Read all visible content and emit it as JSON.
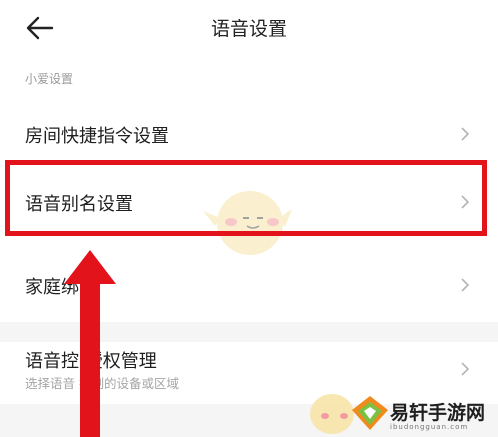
{
  "header": {
    "title": "语音设置",
    "back_icon": "arrow-left-icon"
  },
  "section": {
    "label": "小爱设置"
  },
  "items": [
    {
      "label": "房间快捷指令设置"
    },
    {
      "label": "语音别名设置"
    },
    {
      "label": "家庭绑"
    },
    {
      "label": "语音控 授权管理",
      "sublabel": "选择语音 控制的设备或区域"
    }
  ],
  "annotation": {
    "highlight_color": "#e3131b",
    "arrow_icon": "red-up-arrow"
  },
  "watermark": {
    "text": "易轩手游网",
    "subtext": "ibudongguan.com"
  }
}
